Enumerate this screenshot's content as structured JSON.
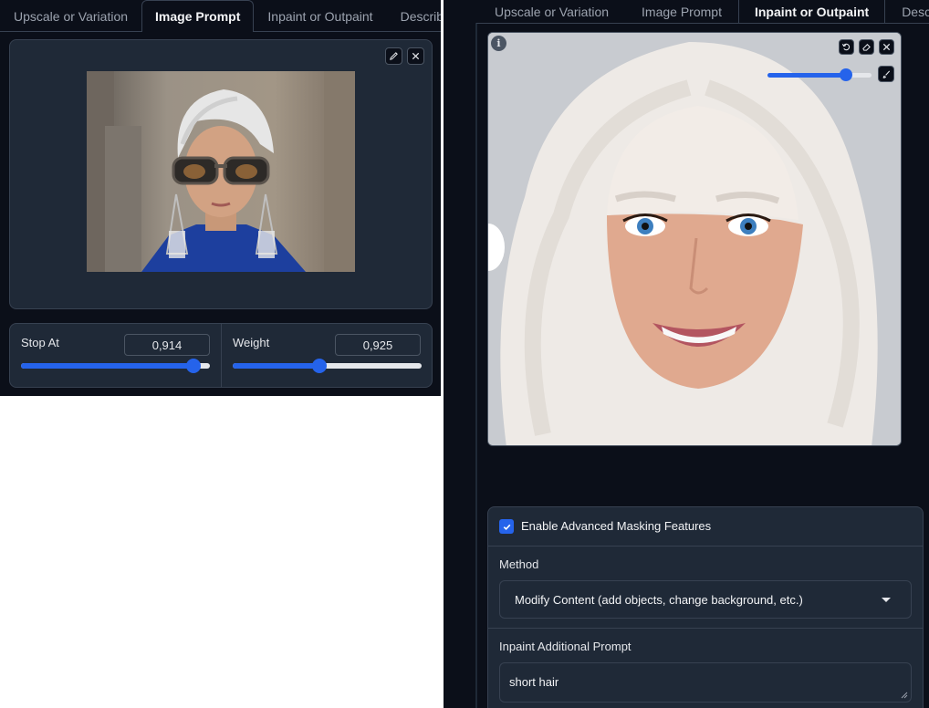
{
  "left_panel": {
    "tabs": [
      {
        "label": "Upscale or Variation",
        "active": false
      },
      {
        "label": "Image Prompt",
        "active": true
      },
      {
        "label": "Inpaint or Outpaint",
        "active": false
      },
      {
        "label": "Describe",
        "active": false
      }
    ],
    "image": {
      "edit_icon": "pencil-icon",
      "close_icon": "close-icon"
    },
    "stop_at": {
      "label": "Stop At",
      "value": "0,914",
      "fraction": 0.914
    },
    "weight": {
      "label": "Weight",
      "value": "0,925",
      "fraction": 0.46
    }
  },
  "right_panel": {
    "tabs": [
      {
        "label": "Upscale or Variation",
        "active": false
      },
      {
        "label": "Image Prompt",
        "active": false
      },
      {
        "label": "Inpaint or Outpaint",
        "active": true
      },
      {
        "label": "Describe",
        "active": false
      }
    ],
    "image": {
      "info_icon": "info-icon",
      "toolbar_icons": [
        "undo-icon",
        "eraser-icon",
        "close-icon"
      ],
      "brush_icon": "brush-icon",
      "brush_size_fraction": 0.75
    },
    "enable_advanced_masking": {
      "label": "Enable Advanced Masking Features",
      "checked": true
    },
    "method": {
      "label": "Method",
      "value": "Modify Content (add objects, change background, etc.)"
    },
    "inpaint_prompt": {
      "label": "Inpaint Additional Prompt",
      "value": "short hair"
    }
  },
  "colors": {
    "accent": "#2563eb",
    "background": "#0b0f19",
    "panel": "#1f2937",
    "border": "#374151"
  }
}
